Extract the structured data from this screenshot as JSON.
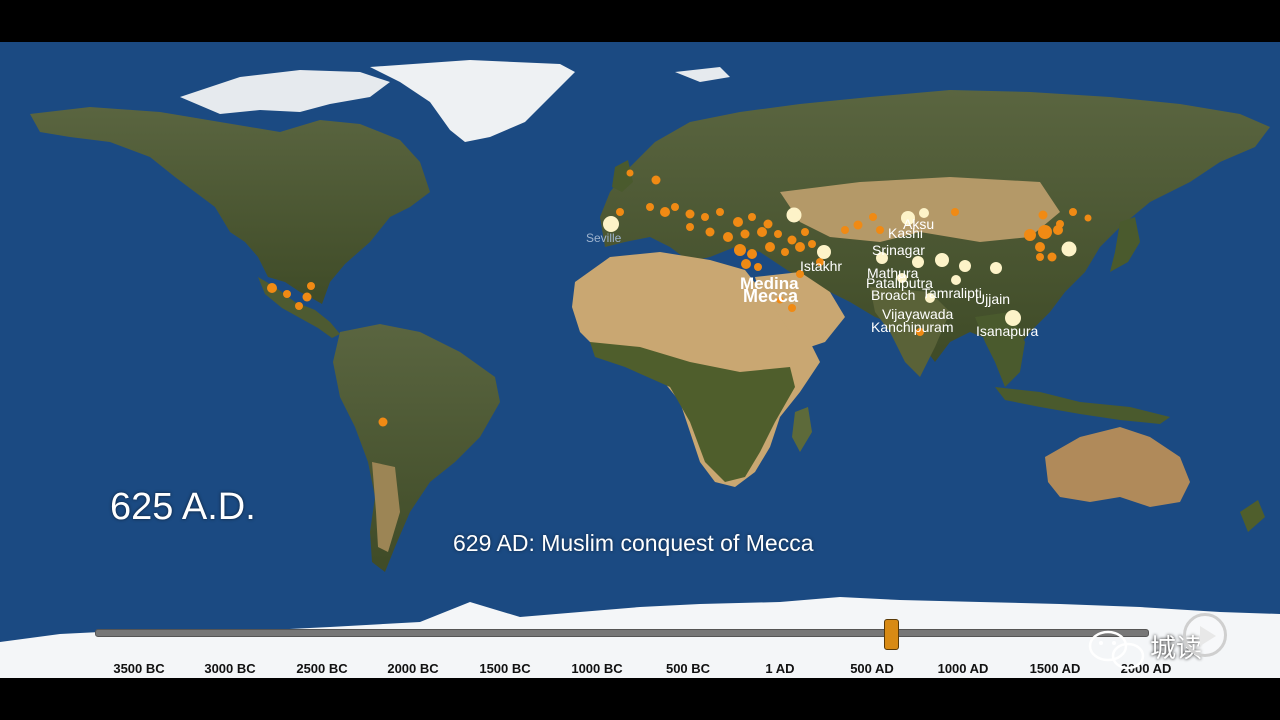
{
  "title_year": "625 A.D.",
  "event_caption": "629 AD: Muslim conquest of Mecca",
  "timeline": {
    "ticks": [
      "3500 BC",
      "3000 BC",
      "2500 BC",
      "2000 BC",
      "1500 BC",
      "1000 BC",
      "500 BC",
      "1 AD",
      "500 AD",
      "1000 AD",
      "1500 AD",
      "2000 AD"
    ],
    "current_year": 625
  },
  "city_labels": [
    "Aksu",
    "Kashi",
    "Srinagar",
    "Istakhr",
    "Medina",
    "Mecca",
    "Mathura",
    "Pataliputra",
    "Broach",
    "Tamralipti",
    "Ujjain",
    "Vijayawada",
    "Kanchipuram",
    "Isanapura",
    "Seville"
  ],
  "watermark_text": "城读",
  "colors": {
    "ocean": "#1b4a82",
    "land": "#4f5b33",
    "desert": "#c9a772",
    "ice": "#f4f6f8",
    "city_small": "#f08a14",
    "city_large": "#fdf3c8"
  }
}
